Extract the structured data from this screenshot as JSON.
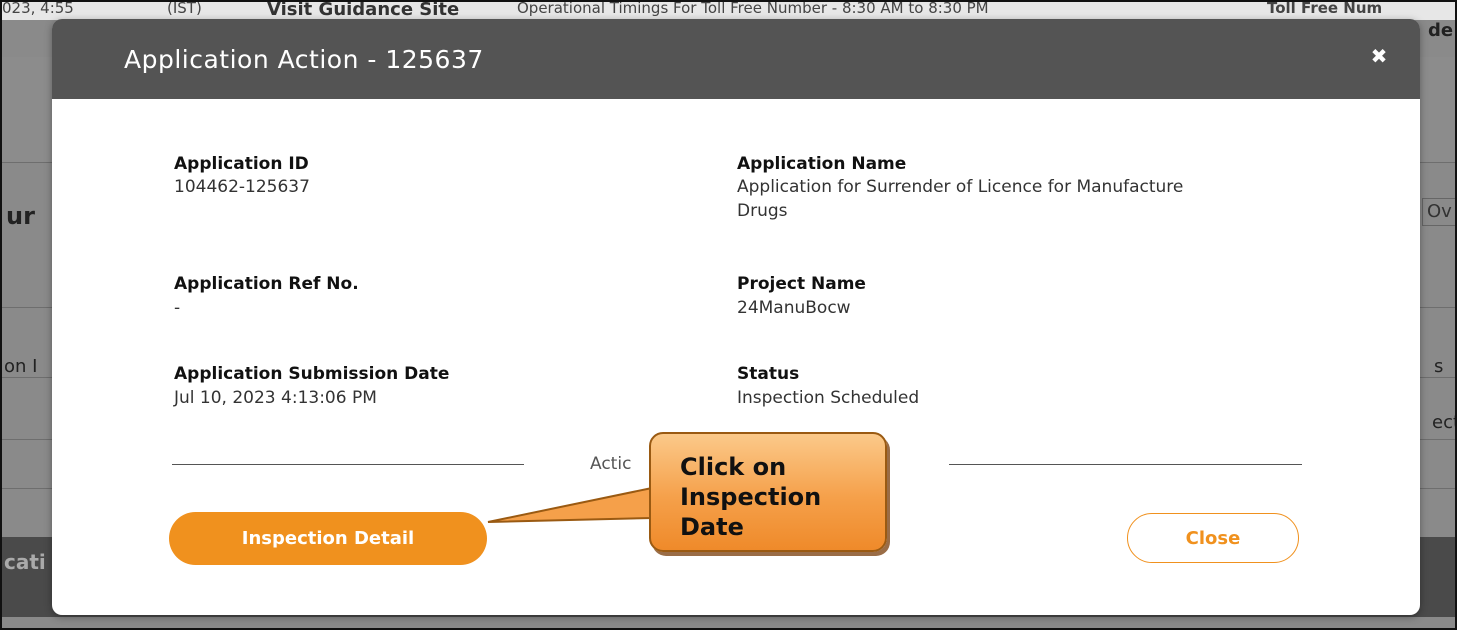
{
  "background": {
    "top_bar": {
      "date_fragment": "023, 4:55",
      "zone_fragment": "(IST)",
      "guidance_link": "Visit Guidance Site",
      "timings": "Operational Timings For Toll Free Number - 8:30 AM to 8:30 PM",
      "tollfree_fragment": "Toll Free Num",
      "right_fragment": "de"
    },
    "left_fragments": [
      "ur",
      "on I",
      "cati"
    ],
    "right_fragments": [
      "Ov",
      "s",
      "ect"
    ]
  },
  "modal": {
    "title": "Application Action - 125637",
    "close_icon": "close-icon",
    "fields": {
      "app_id_label": "Application ID",
      "app_id_value": "104462-125637",
      "app_name_label": "Application Name",
      "app_name_value": "Application for Surrender of Licence for Manufacture Drugs",
      "ref_label": "Application Ref No.",
      "ref_value": "-",
      "project_label": "Project Name",
      "project_value": "24ManuBocw",
      "submission_label": "Application Submission Date",
      "submission_value": "Jul 10, 2023 4:13:06 PM",
      "status_label": "Status",
      "status_value": "Inspection Scheduled"
    },
    "actions_caption": "Actic",
    "inspection_button": "Inspection Detail",
    "close_button": "Close"
  },
  "callout": {
    "text": "Click on Inspection Date"
  },
  "colors": {
    "accent": "#f0911e",
    "header": "#545454",
    "overlay": "#8a8a8a"
  }
}
